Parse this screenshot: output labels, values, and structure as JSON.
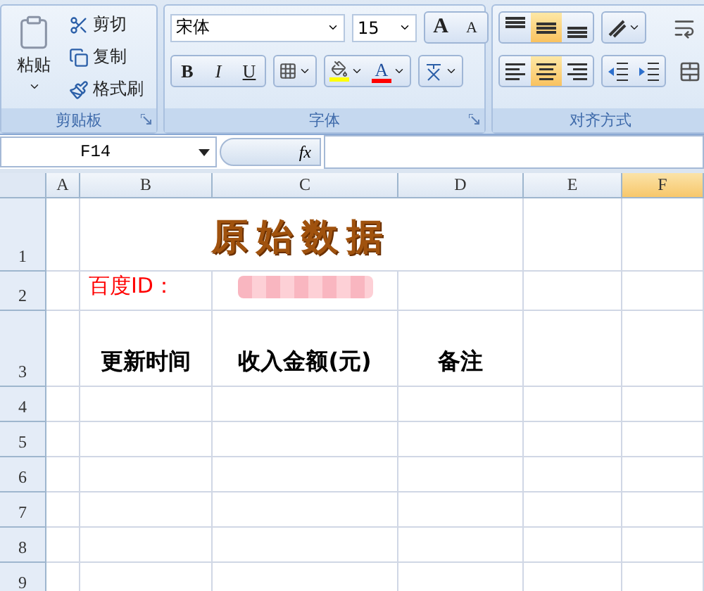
{
  "ribbon": {
    "clipboard": {
      "label": "剪贴板",
      "paste": "粘贴",
      "items": [
        {
          "kind": "cut",
          "label": "剪切"
        },
        {
          "kind": "copy",
          "label": "复制"
        },
        {
          "kind": "painter",
          "label": "格式刷"
        }
      ]
    },
    "font": {
      "label": "字体",
      "font_name": "宋体",
      "font_size": "15",
      "grow": "A",
      "shrink": "A",
      "style_buttons": [
        {
          "kind": "bold",
          "label": "B"
        },
        {
          "kind": "italic",
          "label": "I"
        },
        {
          "kind": "underline",
          "label": "U"
        }
      ],
      "font_color": {
        "label": "A"
      }
    },
    "alignment": {
      "label": "对齐方式",
      "vertical": [
        {
          "kind": "top",
          "selected": false
        },
        {
          "kind": "middle",
          "selected": true
        },
        {
          "kind": "bottom",
          "selected": false
        }
      ],
      "horizontal": [
        {
          "kind": "left",
          "selected": false
        },
        {
          "kind": "center",
          "selected": true
        },
        {
          "kind": "right",
          "selected": false
        }
      ]
    }
  },
  "formula_bar": {
    "name_box": "F14",
    "function_label": "fx"
  },
  "sheet": {
    "columns": [
      {
        "label": "A",
        "selected": false
      },
      {
        "label": "B",
        "selected": false
      },
      {
        "label": "C",
        "selected": false
      },
      {
        "label": "D",
        "selected": false
      },
      {
        "label": "E",
        "selected": false
      },
      {
        "label": "F",
        "selected": true
      }
    ],
    "rows": [
      {
        "header": "1",
        "cells": [
          {
            "kind": "blank"
          },
          {
            "kind": "title",
            "text": "原始数据"
          },
          {
            "kind": "blank"
          },
          {
            "kind": "blank"
          }
        ]
      },
      {
        "header": "2",
        "cells": [
          {
            "kind": "blank"
          },
          {
            "kind": "label",
            "text": "百度ID："
          },
          {
            "kind": "redacted"
          },
          {
            "kind": "blank"
          },
          {
            "kind": "blank"
          },
          {
            "kind": "blank"
          }
        ]
      },
      {
        "header": "3",
        "cells": [
          {
            "kind": "blank"
          },
          {
            "kind": "heading",
            "text": "更新时间"
          },
          {
            "kind": "heading",
            "text": "收入金额(元)"
          },
          {
            "kind": "heading",
            "text": "备注"
          },
          {
            "kind": "blank"
          },
          {
            "kind": "blank"
          }
        ]
      },
      {
        "header": "4"
      },
      {
        "header": "5"
      },
      {
        "header": "6"
      },
      {
        "header": "7"
      },
      {
        "header": "8"
      },
      {
        "header": "9"
      }
    ]
  }
}
